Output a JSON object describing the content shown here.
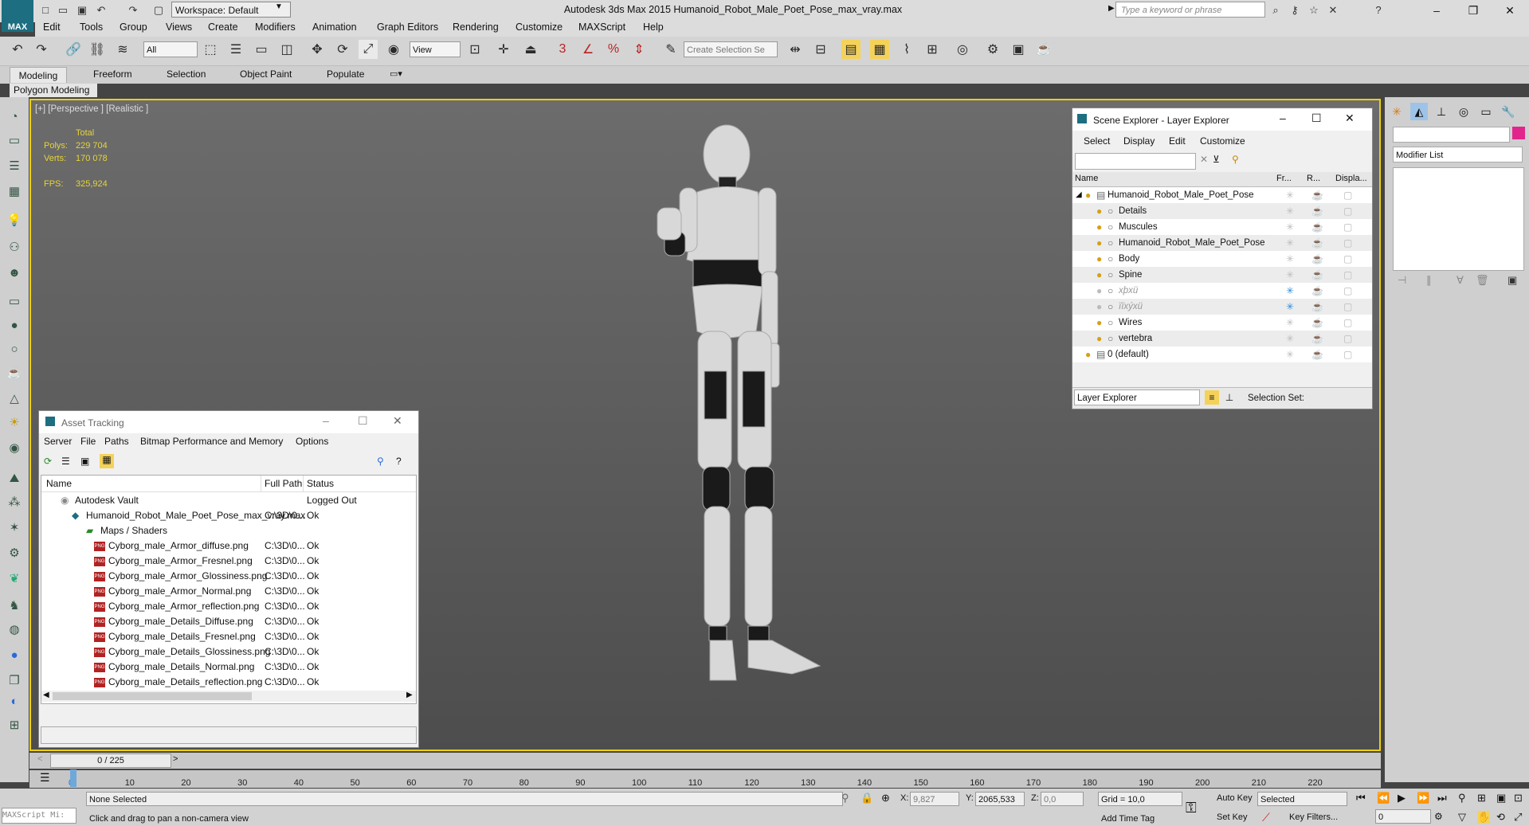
{
  "app": {
    "logo": "MAX",
    "workspace": "Workspace: Default",
    "title": "Autodesk 3ds Max  2015    Humanoid_Robot_Male_Poet_Pose_max_vray.max",
    "search_placeholder": "Type a keyword or phrase"
  },
  "menu": [
    "Edit",
    "Tools",
    "Group",
    "Views",
    "Create",
    "Modifiers",
    "Animation",
    "Graph Editors",
    "Rendering",
    "Customize",
    "MAXScript",
    "Help"
  ],
  "toolbar": {
    "selection_filter": "All",
    "ref_coord": "View",
    "named_selection_placeholder": "Create Selection Se",
    "snap_label": "3",
    "percent_label": "%"
  },
  "ribbon": {
    "tabs": [
      "Modeling",
      "Freeform",
      "Selection",
      "Object Paint",
      "Populate"
    ],
    "subtab": "Polygon Modeling"
  },
  "viewport": {
    "label": "[+] [Perspective ] [Realistic ]",
    "stats": {
      "total_label": "Total",
      "polys_label": "Polys:",
      "polys_value": "229 704",
      "verts_label": "Verts:",
      "verts_value": "170 078",
      "fps_label": "FPS:",
      "fps_value": "325,924"
    }
  },
  "scene_explorer": {
    "title": "Scene Explorer - Layer Explorer",
    "menu": [
      "Select",
      "Display",
      "Edit",
      "Customize"
    ],
    "columns": [
      "Name",
      "Fr...",
      "R...",
      "Displa..."
    ],
    "rows": [
      {
        "name": "Humanoid_Robot_Male_Poet_Pose",
        "level": 0,
        "frozen": false
      },
      {
        "name": "Details",
        "level": 1,
        "frozen": false
      },
      {
        "name": "Muscules",
        "level": 1,
        "frozen": false
      },
      {
        "name": "Humanoid_Robot_Male_Poet_Pose",
        "level": 1,
        "frozen": false
      },
      {
        "name": "Body",
        "level": 1,
        "frozen": false
      },
      {
        "name": "Spine",
        "level": 1,
        "frozen": false
      },
      {
        "name": "xþxü",
        "level": 1,
        "frozen": true
      },
      {
        "name": "ïïxýxü",
        "level": 1,
        "frozen": true
      },
      {
        "name": "Wires",
        "level": 1,
        "frozen": false
      },
      {
        "name": "vertebra",
        "level": 1,
        "frozen": false
      },
      {
        "name": "0 (default)",
        "level": 0,
        "frozen": false
      }
    ],
    "footer_dropdown": "Layer Explorer",
    "selection_set_label": "Selection Set:"
  },
  "asset_tracking": {
    "title": "Asset Tracking",
    "menu": [
      "Server",
      "File",
      "Paths",
      "Bitmap Performance and Memory",
      "Options"
    ],
    "columns": [
      "Name",
      "Full Path",
      "Status"
    ],
    "rows": [
      {
        "name": "Autodesk Vault",
        "path": "",
        "status": "Logged Out",
        "level": 0,
        "icon": "vault"
      },
      {
        "name": "Humanoid_Robot_Male_Poet_Pose_max_vray.max",
        "path": "C:\\3D\\0...",
        "status": "Ok",
        "level": 1,
        "icon": "max"
      },
      {
        "name": "Maps / Shaders",
        "path": "",
        "status": "",
        "level": 2,
        "icon": "folder"
      },
      {
        "name": "Cyborg_male_Armor_diffuse.png",
        "path": "C:\\3D\\0...",
        "status": "Ok",
        "level": 3,
        "icon": "png"
      },
      {
        "name": "Cyborg_male_Armor_Fresnel.png",
        "path": "C:\\3D\\0...",
        "status": "Ok",
        "level": 3,
        "icon": "png"
      },
      {
        "name": "Cyborg_male_Armor_Glossiness.png",
        "path": "C:\\3D\\0...",
        "status": "Ok",
        "level": 3,
        "icon": "png"
      },
      {
        "name": "Cyborg_male_Armor_Normal.png",
        "path": "C:\\3D\\0...",
        "status": "Ok",
        "level": 3,
        "icon": "png"
      },
      {
        "name": "Cyborg_male_Armor_reflection.png",
        "path": "C:\\3D\\0...",
        "status": "Ok",
        "level": 3,
        "icon": "png"
      },
      {
        "name": "Cyborg_male_Details_Diffuse.png",
        "path": "C:\\3D\\0...",
        "status": "Ok",
        "level": 3,
        "icon": "png"
      },
      {
        "name": "Cyborg_male_Details_Fresnel.png",
        "path": "C:\\3D\\0...",
        "status": "Ok",
        "level": 3,
        "icon": "png"
      },
      {
        "name": "Cyborg_male_Details_Glossiness.png",
        "path": "C:\\3D\\0...",
        "status": "Ok",
        "level": 3,
        "icon": "png"
      },
      {
        "name": "Cyborg_male_Details_Normal.png",
        "path": "C:\\3D\\0...",
        "status": "Ok",
        "level": 3,
        "icon": "png"
      },
      {
        "name": "Cyborg_male_Details_reflection.png",
        "path": "C:\\3D\\0...",
        "status": "Ok",
        "level": 3,
        "icon": "png"
      }
    ]
  },
  "command_panel": {
    "modifier_list": "Modifier List"
  },
  "timeline": {
    "frame_indicator": "0 / 225",
    "ruler": [
      "0",
      "10",
      "20",
      "30",
      "40",
      "50",
      "60",
      "70",
      "80",
      "90",
      "100",
      "110",
      "120",
      "130",
      "140",
      "150",
      "160",
      "170",
      "180",
      "190",
      "200",
      "210",
      "220"
    ]
  },
  "status": {
    "maxscript": "MAXScript Mi:",
    "selection": "None Selected",
    "prompt": "Click and drag to pan a non-camera view",
    "x_label": "X:",
    "x_value": "9,827",
    "y_label": "Y:",
    "y_value": "2065,533",
    "z_label": "Z:",
    "z_value": "0,0",
    "grid": "Grid = 10,0",
    "add_time_tag": "Add Time Tag",
    "auto_key": "Auto Key",
    "set_key": "Set Key",
    "key_mode": "Selected",
    "key_filters": "Key Filters...",
    "current_frame": "0"
  }
}
